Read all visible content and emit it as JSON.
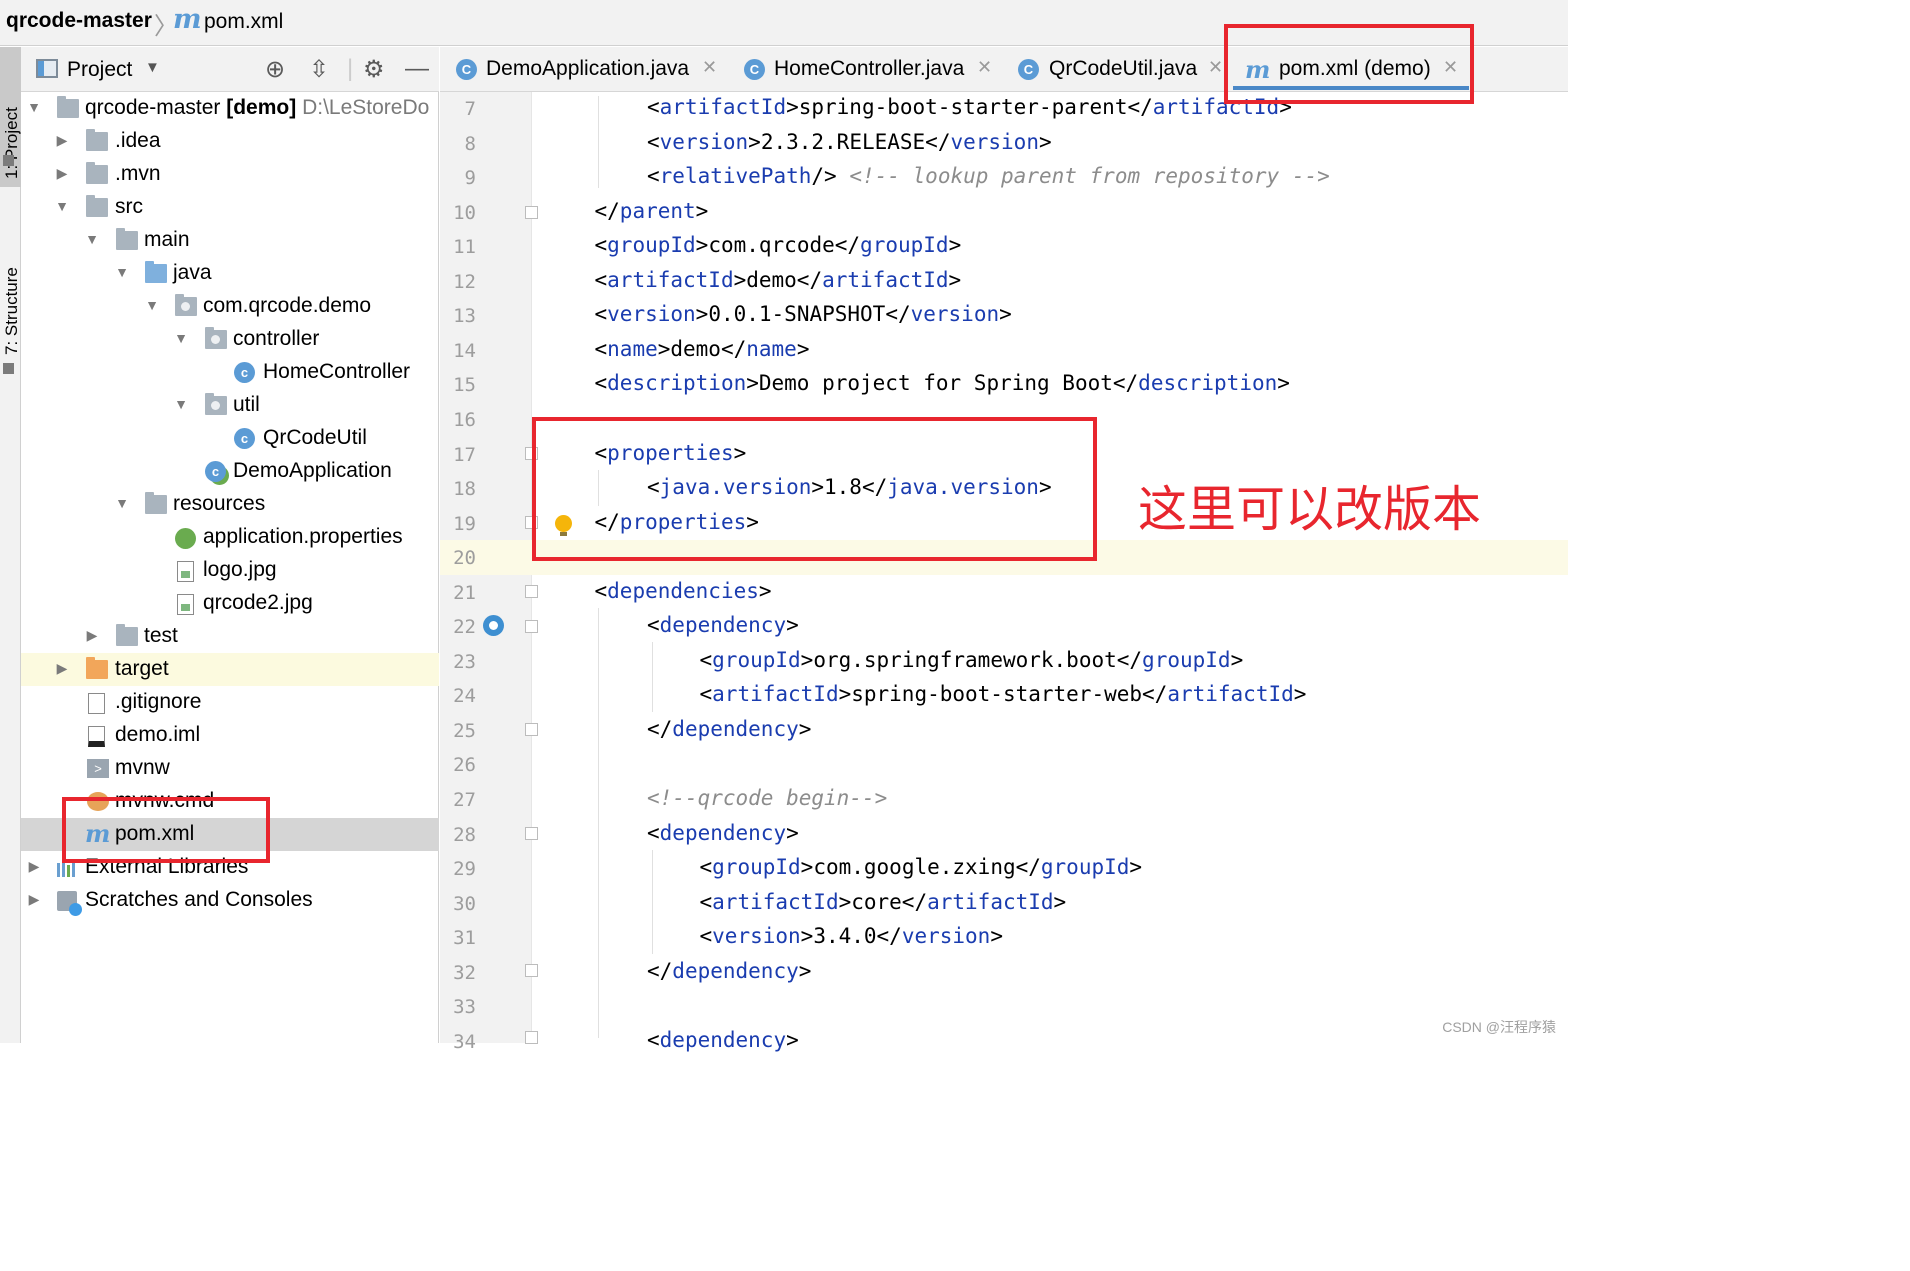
{
  "breadcrumb": {
    "project": "qrcode-master",
    "file_icon": "m",
    "file": "pom.xml"
  },
  "tool_strip": {
    "project_tab": "1: Project",
    "structure_tab": "7: Structure"
  },
  "project_panel": {
    "title": "Project"
  },
  "tree": {
    "root_name": "qrcode-master",
    "root_module": "[demo]",
    "root_path": "D:\\LeStoreDo",
    "items": [
      {
        "label": ".idea"
      },
      {
        "label": ".mvn"
      },
      {
        "label": "src"
      },
      {
        "label": "main"
      },
      {
        "label": "java"
      },
      {
        "label": "com.qrcode.demo"
      },
      {
        "label": "controller"
      },
      {
        "label": "HomeController"
      },
      {
        "label": "util"
      },
      {
        "label": "QrCodeUtil"
      },
      {
        "label": "DemoApplication"
      },
      {
        "label": "resources"
      },
      {
        "label": "application.properties"
      },
      {
        "label": "logo.jpg"
      },
      {
        "label": "qrcode2.jpg"
      },
      {
        "label": "test"
      },
      {
        "label": "target"
      },
      {
        "label": ".gitignore"
      },
      {
        "label": "demo.iml"
      },
      {
        "label": "mvnw"
      },
      {
        "label": "mvnw.cmd"
      },
      {
        "label": "pom.xml"
      },
      {
        "label": "External Libraries"
      },
      {
        "label": "Scratches and Consoles"
      }
    ]
  },
  "tabs": [
    {
      "label": "DemoApplication.java",
      "icon": "C"
    },
    {
      "label": "HomeController.java",
      "icon": "C"
    },
    {
      "label": "QrCodeUtil.java",
      "icon": "C"
    },
    {
      "label": "pom.xml (demo)",
      "icon": "m"
    }
  ],
  "editor": {
    "lines": [
      {
        "n": "7",
        "a": "<",
        "t": "artifactId",
        "b": ">spring-boot-starter-parent</",
        "t2": "artifactId",
        "c": ">"
      },
      {
        "n": "8",
        "a": "<",
        "t": "version",
        "b": ">2.3.2.RELEASE</",
        "t2": "version",
        "c": ">"
      },
      {
        "n": "9",
        "a": "<",
        "t": "relativePath",
        "b": "/> ",
        "t2": "",
        "c": "",
        "comment": "<!-- lookup parent from repository -->"
      },
      {
        "n": "10",
        "a": "</",
        "t": "parent",
        "b": ">",
        "t2": "",
        "c": ""
      },
      {
        "n": "11",
        "a": "<",
        "t": "groupId",
        "b": ">com.qrcode</",
        "t2": "groupId",
        "c": ">"
      },
      {
        "n": "12",
        "a": "<",
        "t": "artifactId",
        "b": ">demo</",
        "t2": "artifactId",
        "c": ">"
      },
      {
        "n": "13",
        "a": "<",
        "t": "version",
        "b": ">0.0.1-SNAPSHOT</",
        "t2": "version",
        "c": ">"
      },
      {
        "n": "14",
        "a": "<",
        "t": "name",
        "b": ">demo</",
        "t2": "name",
        "c": ">"
      },
      {
        "n": "15",
        "a": "<",
        "t": "description",
        "b": ">Demo project for Spring Boot</",
        "t2": "description",
        "c": ">"
      },
      {
        "n": "16"
      },
      {
        "n": "17",
        "a": "<",
        "t": "properties",
        "b": ">",
        "t2": "",
        "c": ""
      },
      {
        "n": "18",
        "a": "<",
        "t": "java.version",
        "b": ">1.8</",
        "t2": "java.version",
        "c": ">"
      },
      {
        "n": "19",
        "a": "</",
        "t": "properties",
        "b": ">",
        "t2": "",
        "c": ""
      },
      {
        "n": "20"
      },
      {
        "n": "21",
        "a": "<",
        "t": "dependencies",
        "b": ">",
        "t2": "",
        "c": ""
      },
      {
        "n": "22",
        "a": "<",
        "t": "dependency",
        "b": ">",
        "t2": "",
        "c": ""
      },
      {
        "n": "23",
        "a": "<",
        "t": "groupId",
        "b": ">org.springframework.boot</",
        "t2": "groupId",
        "c": ">"
      },
      {
        "n": "24",
        "a": "<",
        "t": "artifactId",
        "b": ">spring-boot-starter-web</",
        "t2": "artifactId",
        "c": ">"
      },
      {
        "n": "25",
        "a": "</",
        "t": "dependency",
        "b": ">",
        "t2": "",
        "c": ""
      },
      {
        "n": "26"
      },
      {
        "n": "27",
        "comment": "<!--qrcode begin-->"
      },
      {
        "n": "28",
        "a": "<",
        "t": "dependency",
        "b": ">",
        "t2": "",
        "c": ""
      },
      {
        "n": "29",
        "a": "<",
        "t": "groupId",
        "b": ">com.google.zxing</",
        "t2": "groupId",
        "c": ">"
      },
      {
        "n": "30",
        "a": "<",
        "t": "artifactId",
        "b": ">core</",
        "t2": "artifactId",
        "c": ">"
      },
      {
        "n": "31",
        "a": "<",
        "t": "version",
        "b": ">3.4.0</",
        "t2": "version",
        "c": ">"
      },
      {
        "n": "32",
        "a": "</",
        "t": "dependency",
        "b": ">",
        "t2": "",
        "c": ""
      },
      {
        "n": "33"
      },
      {
        "n": "34",
        "a": "<",
        "t": "dependency",
        "b": ">",
        "t2": "",
        "c": ""
      }
    ]
  },
  "annotation": {
    "text": "这里可以改版本"
  },
  "watermark": "CSDN @汪程序猿",
  "colors": {
    "tag": "#1a3caf",
    "highlight_box": "#e8262e",
    "accent": "#5b9bd5"
  }
}
